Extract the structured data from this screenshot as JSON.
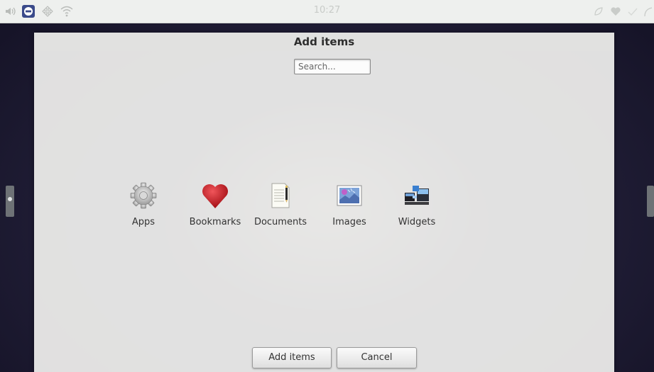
{
  "status_bar": {
    "time": "10:27",
    "left_icons": [
      "speaker-icon",
      "no-entry-icon",
      "network-icon",
      "wifi-icon"
    ],
    "right_icons": [
      "leaf-icon",
      "heart-icon",
      "check-icon",
      "arrow-icon"
    ]
  },
  "dialog": {
    "title": "Add items",
    "search": {
      "placeholder": "Search...",
      "value": ""
    },
    "items": [
      {
        "label": "Apps",
        "icon": "gear-icon"
      },
      {
        "label": "Bookmarks",
        "icon": "heart-icon"
      },
      {
        "label": "Documents",
        "icon": "document-icon"
      },
      {
        "label": "Images",
        "icon": "image-icon"
      },
      {
        "label": "Widgets",
        "icon": "widgets-icon"
      }
    ],
    "buttons": {
      "add_label": "Add items",
      "cancel_label": "Cancel"
    }
  },
  "colors": {
    "dialog_background": "#f0f0ee",
    "status_bar": "#eef0ee",
    "bookmark_heart": "#c8151c"
  }
}
